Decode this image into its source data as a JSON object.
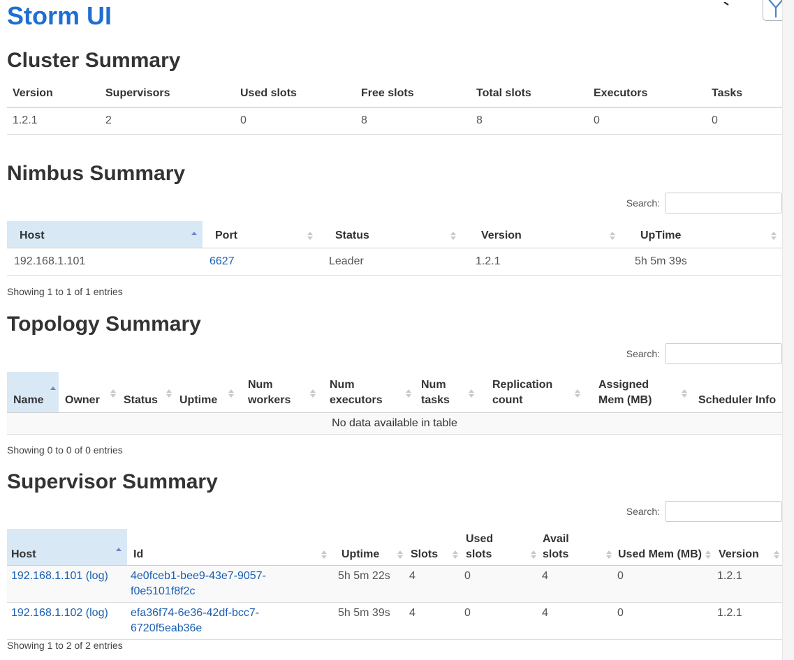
{
  "brand": "Storm UI",
  "cluster": {
    "title": "Cluster Summary",
    "headers": [
      "Version",
      "Supervisors",
      "Used slots",
      "Free slots",
      "Total slots",
      "Executors",
      "Tasks"
    ],
    "row": [
      "1.2.1",
      "2",
      "0",
      "8",
      "8",
      "0",
      "0"
    ]
  },
  "nimbus": {
    "title": "Nimbus Summary",
    "search_label": "Search:",
    "headers": [
      "Host",
      "Port",
      "Status",
      "Version",
      "UpTime"
    ],
    "row": {
      "host": "192.168.1.101",
      "port": "6627",
      "status": "Leader",
      "version": "1.2.1",
      "uptime": "5h 5m 39s"
    },
    "info": "Showing 1 to 1 of 1 entries"
  },
  "topology": {
    "title": "Topology Summary",
    "search_label": "Search:",
    "headers": [
      "Name",
      "Owner",
      "Status",
      "Uptime",
      "Num workers",
      "Num executors",
      "Num tasks",
      "Replication count",
      "Assigned Mem (MB)",
      "Scheduler Info"
    ],
    "empty": "No data available in table",
    "info": "Showing 0 to 0 of 0 entries"
  },
  "supervisor": {
    "title": "Supervisor Summary",
    "search_label": "Search:",
    "headers": [
      "Host",
      "Id",
      "Uptime",
      "Slots",
      "Used slots",
      "Avail slots",
      "Used Mem (MB)",
      "Version"
    ],
    "log_label": "(log)",
    "rows": [
      {
        "host": "192.168.1.101",
        "id": "4e0fceb1-bee9-43e7-9057-f0e5101f8f2c",
        "uptime": "5h 5m 22s",
        "slots": "4",
        "used_slots": "0",
        "avail_slots": "4",
        "used_mem": "0",
        "version": "1.2.1"
      },
      {
        "host": "192.168.1.102",
        "id": "efa36f74-6e36-42df-bcc7-6720f5eab36e",
        "uptime": "5h 5m 39s",
        "slots": "4",
        "used_slots": "0",
        "avail_slots": "4",
        "used_mem": "0",
        "version": "1.2.1"
      }
    ],
    "info": "Showing 1 to 2 of 2 entries"
  }
}
